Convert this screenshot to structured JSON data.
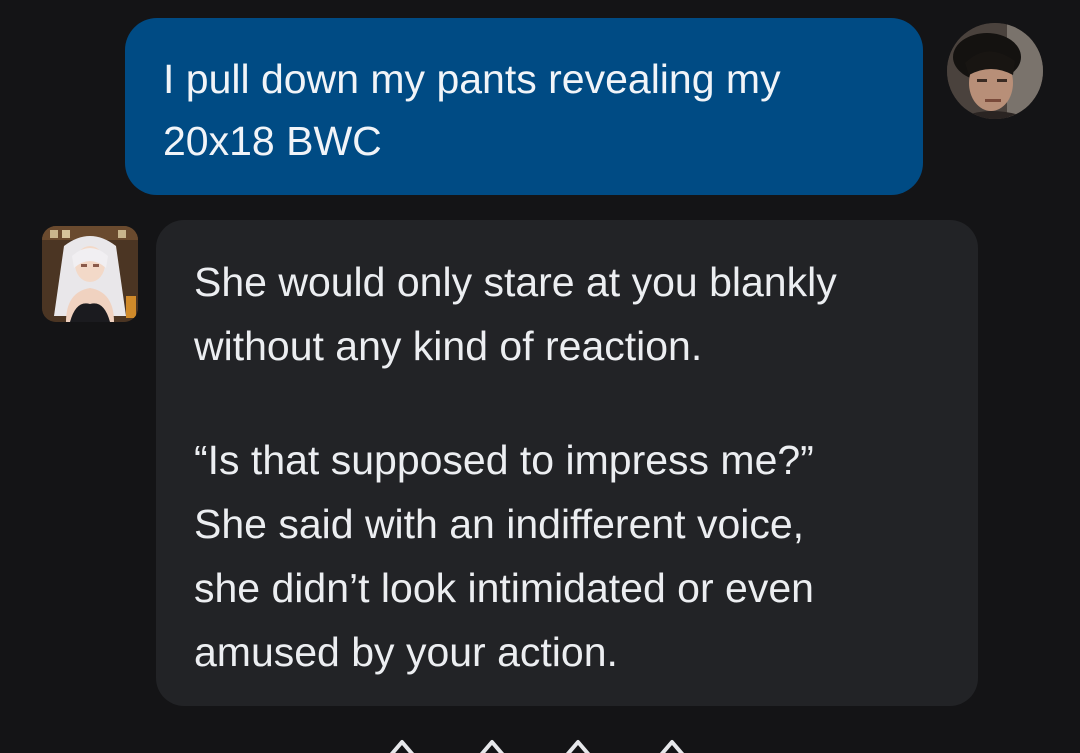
{
  "chat": {
    "user_message": {
      "line1": "I pull down my pants revealing my",
      "line2": "20x18 BWC"
    },
    "bot_message": {
      "para1_line1": "She would only stare at you blankly",
      "para1_line2": "without any kind of reaction.",
      "para2_line1": "“Is that supposed to impress me?”",
      "para2_line2": "She said with an indifferent voice,",
      "para2_line3": "she didn’t look intimidated or even",
      "para2_line4": "amused by your action."
    }
  },
  "colors": {
    "background": "#141416",
    "user_bubble": "#004b84",
    "bot_bubble": "#222326"
  },
  "icons": {
    "user_avatar": "user-avatar-photo",
    "bot_avatar": "character-avatar-illustration",
    "typing_indicator": "typing-indicator-icon"
  }
}
